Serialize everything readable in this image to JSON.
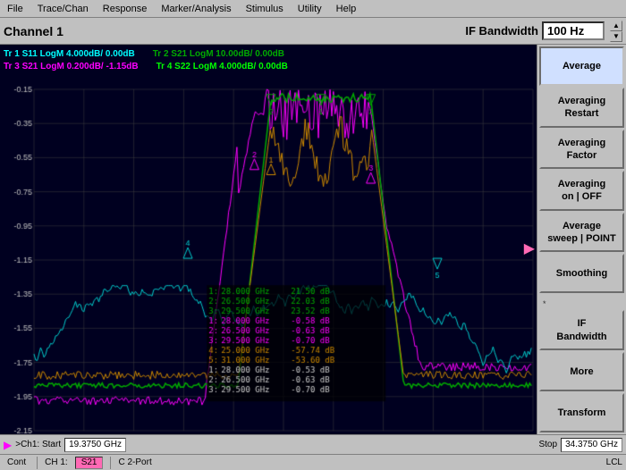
{
  "menubar": {
    "items": [
      "File",
      "Trace/Chan",
      "Response",
      "Marker/Analysis",
      "Stimulus",
      "Utility",
      "Help"
    ]
  },
  "toolbar": {
    "channel_label": "Channel 1",
    "if_bw_label": "IF Bandwidth",
    "if_bw_value": "100 Hz"
  },
  "traces": {
    "row1_tr1": "Tr 1  S11 LogM 4.000dB/  0.00dB",
    "row1_tr2": "Tr 2  S21 LogM 10.00dB/  0.00dB",
    "row2_tr3": "Tr 3  S21 LogM 0.200dB/  -1.15dB",
    "row2_tr4": "Tr 4  S22 LogM 4.000dB/  0.00dB"
  },
  "sidebar": {
    "buttons": [
      {
        "id": "average",
        "label": "Average",
        "active": true
      },
      {
        "id": "averaging-restart",
        "label": "Averaging\nRestart"
      },
      {
        "id": "averaging-factor",
        "label": "Averaging\nFactor"
      },
      {
        "id": "averaging-on-off",
        "label": "Averaging\non | OFF"
      },
      {
        "id": "average-sweep",
        "label": "Average\nsweep | POINT"
      },
      {
        "id": "smoothing",
        "label": "Smoothing"
      },
      {
        "id": "if-bandwidth",
        "label": "IF\nBandwidth"
      },
      {
        "id": "more",
        "label": "More"
      },
      {
        "id": "transform",
        "label": "Transform"
      }
    ]
  },
  "bottom_bar": {
    "start_label": "Start",
    "start_value": "19.3750 GHz",
    "stop_label": "Stop",
    "stop_value": "34.3750 GHz"
  },
  "status_bar": {
    "cont": "Cont",
    "ch1": "CH 1:",
    "s21": "S21",
    "port": "C 2-Port",
    "lcl": "LCL"
  },
  "y_axis": {
    "labels": [
      "-0.15",
      "-0.35",
      "-0.55",
      "-0.75",
      "-0.95",
      "-1.15",
      "-1.35",
      "-1.55",
      "-1.75",
      "-1.95",
      "-2.15"
    ]
  },
  "markers": {
    "rows": [
      {
        "num": "1:",
        "freq": "28.000 GHz",
        "val1": "21.50 dB"
      },
      {
        "num": "2:",
        "freq": "26.500 GHz",
        "val1": "22.03 dB"
      },
      {
        "num": "3:",
        "freq": "29.500 GHz",
        "val1": "23.52 dB"
      },
      {
        "num": "1:",
        "freq": "28.000 GHz",
        "val1": "-0.58 dB"
      },
      {
        "num": "2:",
        "freq": "26.500 GHz",
        "val1": "-0.63 dB"
      },
      {
        "num": "3:",
        "freq": "29.500 GHz",
        "val1": "-0.70 dB"
      },
      {
        "num": "4:",
        "freq": "25.000 GHz",
        "val1": "-57.74 dB"
      },
      {
        "num": "5:",
        "freq": "31.000 GHz",
        "val1": "-53.60 dB"
      },
      {
        "num": "1:",
        "freq": "28.000 GHz",
        "val1": "-0.53 dB"
      },
      {
        "num": "2:",
        "freq": "26.500 GHz",
        "val1": "-0.63 dB"
      },
      {
        "num": "3:",
        "freq": "29.500 GHz",
        "val1": "-0.70 dB"
      }
    ]
  }
}
